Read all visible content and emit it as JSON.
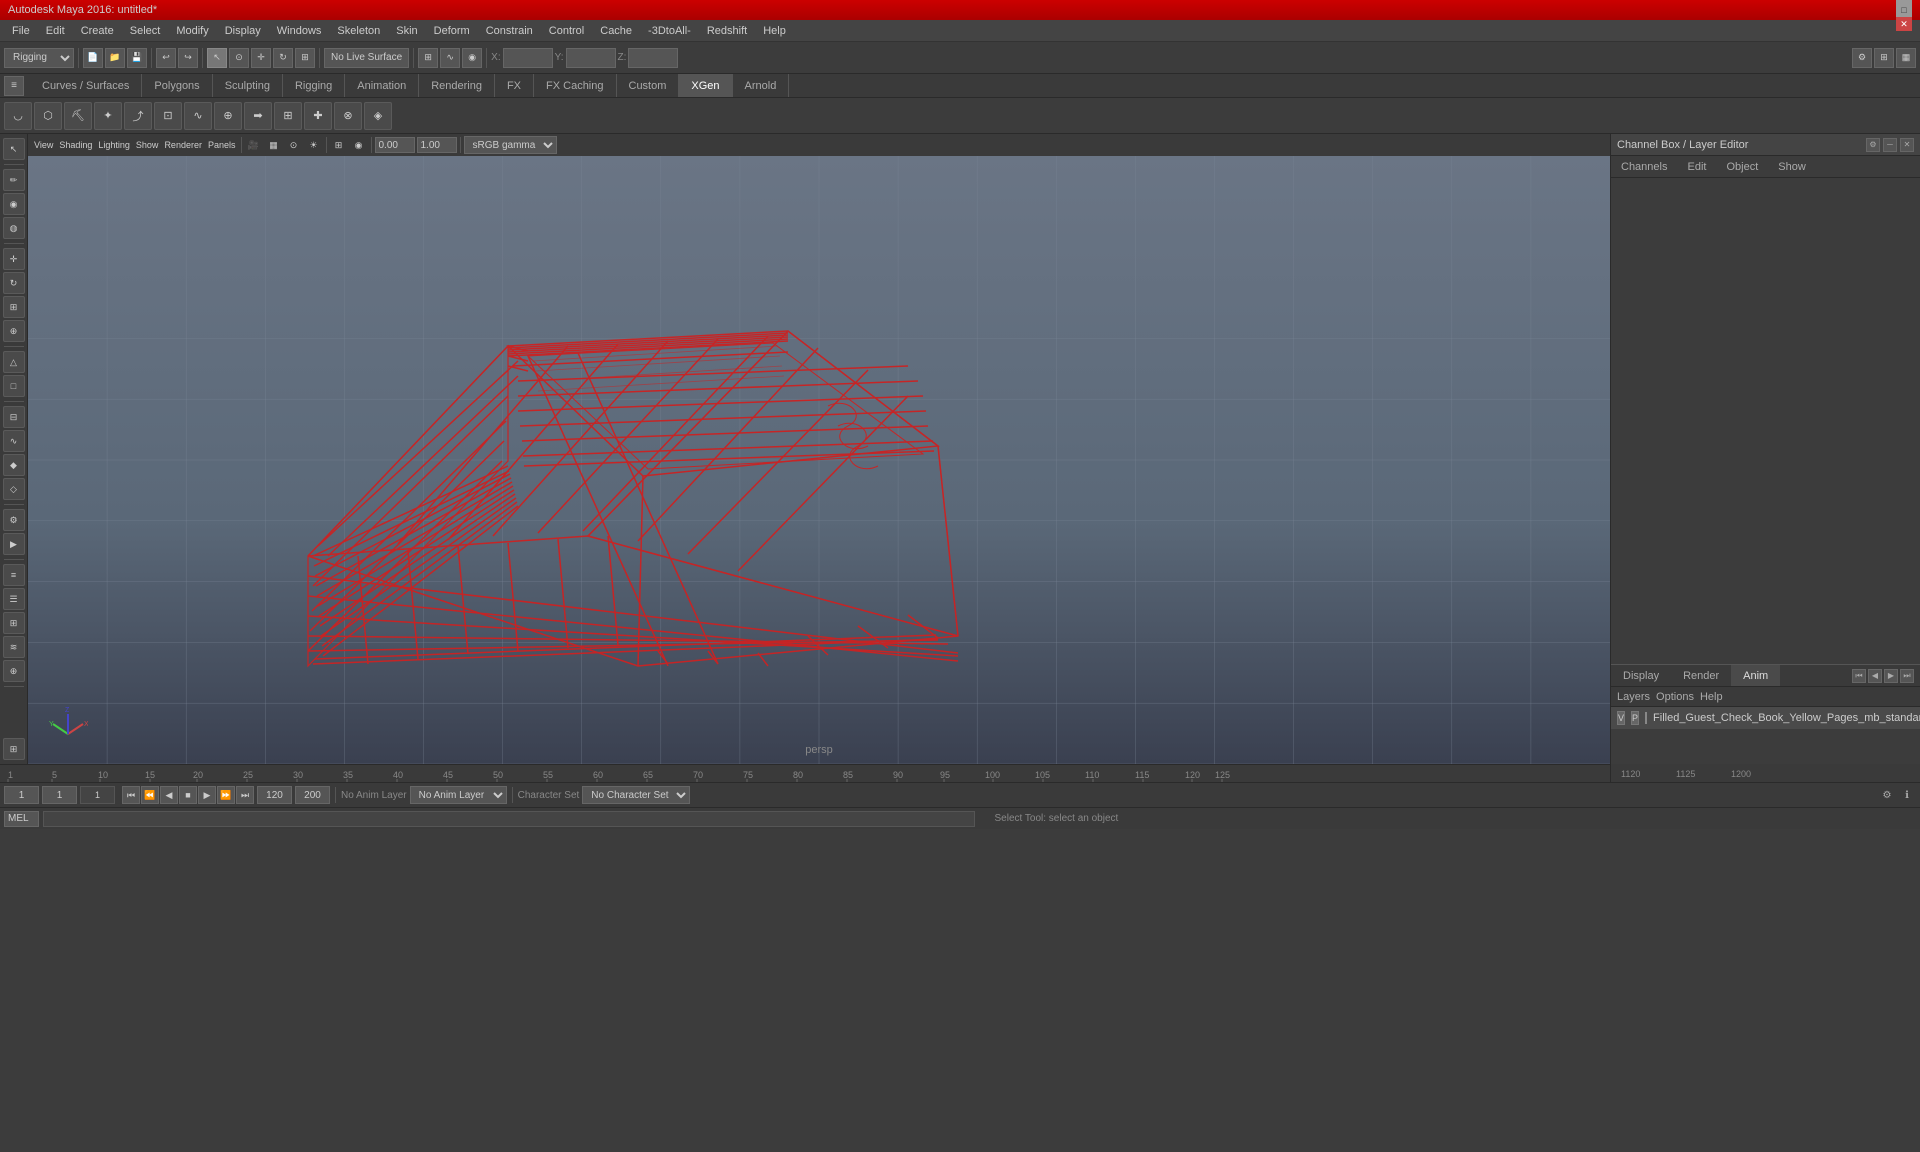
{
  "titlebar": {
    "title": "Autodesk Maya 2016: untitled*",
    "minimize_label": "─",
    "maximize_label": "□",
    "close_label": "✕"
  },
  "menubar": {
    "items": [
      "File",
      "Edit",
      "Create",
      "Select",
      "Modify",
      "Display",
      "Windows",
      "Skeleton",
      "Skin",
      "Deform",
      "Constrain",
      "Control",
      "Cache",
      "-3DtoAll-",
      "Redshift",
      "Help"
    ]
  },
  "toolbar": {
    "mode_dropdown": "Rigging",
    "no_live_surface": "No Live Surface",
    "x_label": "X:",
    "y_label": "Y:",
    "z_label": "Z:"
  },
  "module_tabs": {
    "tabs": [
      "Curves / Surfaces",
      "Polygons",
      "Sculpting",
      "Rigging",
      "Animation",
      "Rendering",
      "FX",
      "FX Caching",
      "Custom",
      "XGen",
      "Arnold"
    ]
  },
  "viewport_toolbar": {
    "menus": [
      "View",
      "Shading",
      "Lighting",
      "Show",
      "Renderer",
      "Panels"
    ],
    "field_of_view": "0.00",
    "near_clip": "1.00",
    "gamma": "sRGB gamma"
  },
  "viewport": {
    "label": "persp"
  },
  "channel_box": {
    "title": "Channel Box / Layer Editor",
    "tabs": [
      "Channels",
      "Edit",
      "Object",
      "Show"
    ]
  },
  "layer_editor": {
    "tabs": [
      "Display",
      "Render",
      "Anim"
    ],
    "active_tab": "Anim",
    "options": [
      "Layers",
      "Options",
      "Help"
    ],
    "layer_item": {
      "visibility": "V",
      "playback": "P",
      "color": "#cc0000",
      "name": "Filled_Guest_Check_Book_Yellow_Pages_mb_standart:Fill"
    }
  },
  "timeline": {
    "start_frame": "1",
    "end_frame": "120",
    "ticks": [
      "1",
      "5",
      "10",
      "15",
      "20",
      "25",
      "30",
      "35",
      "40",
      "45",
      "50",
      "55",
      "60",
      "65",
      "70",
      "75",
      "80",
      "85",
      "90",
      "95",
      "100",
      "105",
      "110",
      "115",
      "120",
      "125",
      "1120",
      "1200"
    ]
  },
  "bottom_controls": {
    "frame_start": "1",
    "frame_current": "1",
    "frame_end": "120",
    "frame_end2": "200",
    "anim_layer_label": "No Anim Layer",
    "char_set_label": "Character Set",
    "char_set_value": "No Character Set",
    "playback_btns": [
      "⏮",
      "⏪",
      "◀",
      "▶",
      "▶▶",
      "⏩",
      "⏭"
    ]
  },
  "status_bar": {
    "command_type": "MEL",
    "status_text": "Select Tool: select an object"
  },
  "shelf_icons": [
    "✦",
    "◈",
    "⊕",
    "⊗",
    "⊞",
    "⊟",
    "◉",
    "●",
    "○",
    "◆",
    "▲",
    "✚",
    "⚙",
    "≡"
  ],
  "left_toolbar_icons": [
    "↖",
    "↔",
    "↕",
    "⟲",
    "⊕",
    "△",
    "□",
    "◇",
    "⬡",
    "∿",
    "≋",
    "☰",
    "⊞"
  ],
  "icons": {
    "search": "🔍",
    "gear": "⚙",
    "close": "✕",
    "minimize": "─",
    "maximize": "□",
    "arrow_left": "◀",
    "arrow_right": "▶",
    "play": "▶",
    "stop": "⏹",
    "skip_start": "⏮",
    "skip_end": "⏭",
    "fast_forward": "⏩",
    "rewind": "⏪"
  }
}
